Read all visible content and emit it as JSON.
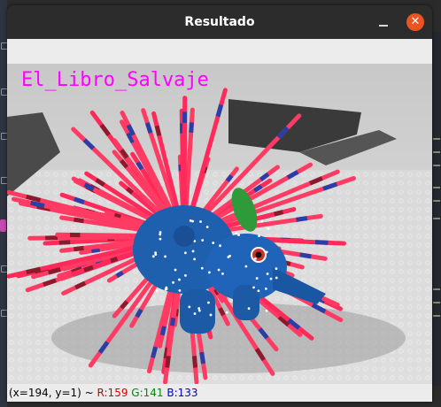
{
  "window": {
    "title": "Resultado",
    "close_glyph": "✕",
    "minimize_icon": "minimize-icon",
    "close_icon": "close-icon"
  },
  "image": {
    "overlay_text": "El_Libro_Salvaje",
    "overlay_color": "#ff00ff"
  },
  "status": {
    "coords": "(x=194, y=1) ~",
    "r": "R:159",
    "g": "G:141",
    "b": "B:133"
  },
  "colors": {
    "accent_close": "#e95420",
    "r_color": "#d00000",
    "g_color": "#008a00",
    "b_color": "#0000cc"
  }
}
